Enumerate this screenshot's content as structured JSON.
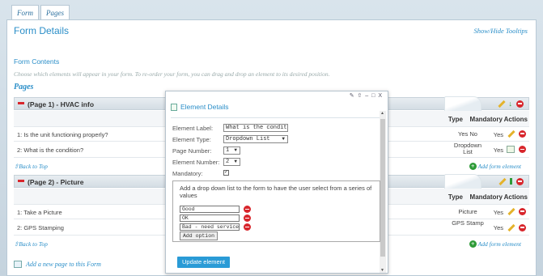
{
  "tabs": [
    "Form",
    "Pages"
  ],
  "header": {
    "title": "Form Details",
    "toggle_tooltips": "Show/Hide Tooltips"
  },
  "contents": {
    "heading": "Form Contents",
    "description": "Choose which elements will appear in your form. To re-order your form, you can drag and drop an element to its desired position.",
    "pages_label": "Pages"
  },
  "columns": {
    "type": "Type",
    "mandatory": "Mandatory",
    "actions": "Actions"
  },
  "pages": [
    {
      "title": "(Page 1) - HVAC info",
      "rows": [
        {
          "question": "1: Is the unit functioning properly?",
          "type": "Yes No",
          "mandatory": "Yes"
        },
        {
          "question": "2: What is the condition?",
          "type": "Dropdown List",
          "mandatory": "Yes"
        }
      ]
    },
    {
      "title": "(Page 2) - Picture",
      "rows": [
        {
          "question": "1: Take a Picture",
          "type": "Picture",
          "mandatory": "Yes"
        },
        {
          "question": "2: GPS Stamping",
          "type": "GPS Stamp",
          "mandatory": "Yes"
        }
      ]
    }
  ],
  "links": {
    "back_to_top": "Back to Top",
    "add_form_element": "Add form element",
    "add_page": "Add a new page to this Form"
  },
  "modal": {
    "title": "Element Details",
    "controls": "✎ ⇧ – □ X",
    "fields": {
      "label_label": "Element Label:",
      "label_value": "What is the conditio",
      "type_label": "Element Type:",
      "type_value": "Dropdown List",
      "page_label": "Page Number:",
      "page_value": "1",
      "number_label": "Element Number:",
      "number_value": "2",
      "mandatory_label": "Mandatory:"
    },
    "options_description": "Add a drop down list to the form to have the user select from a series of values",
    "options": [
      "Good",
      "OK",
      "Bad - need service"
    ],
    "add_option": "Add option",
    "update_button": "Update element"
  }
}
